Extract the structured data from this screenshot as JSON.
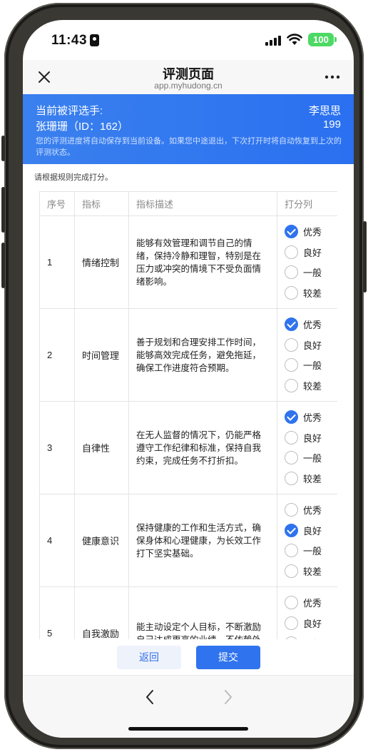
{
  "status": {
    "time": "11:43",
    "battery": "100"
  },
  "nav": {
    "title": "评测页面",
    "url": "app.myhudong.cn"
  },
  "header": {
    "candidate_label": "当前被评选手:",
    "candidate_name": "张珊珊（ID：162）",
    "assessor": "李思思",
    "score": "199",
    "note": "您的评测进度将自动保存到当前设备。如果您中途退出，下次打开时将自动恢复到上次的评测状态。"
  },
  "rule_note": "请根据规则完成打分。",
  "table": {
    "headers": [
      "序号",
      "指标",
      "指标描述",
      "打分列"
    ],
    "options": [
      "优秀",
      "良好",
      "一般",
      "较差"
    ],
    "rows": [
      {
        "index": "1",
        "indicator": "情绪控制",
        "description": "能够有效管理和调节自己的情绪，保持冷静和理智，特别是在压力或冲突的情境下不受负面情绪影响。",
        "selected": "优秀"
      },
      {
        "index": "2",
        "indicator": "时间管理",
        "description": "善于规划和合理安排工作时间，能够高效完成任务，避免拖延，确保工作进度符合预期。",
        "selected": "优秀"
      },
      {
        "index": "3",
        "indicator": "自律性",
        "description": "在无人监督的情况下，仍能严格遵守工作纪律和标准，保持自我约束，完成任务不打折扣。",
        "selected": "优秀"
      },
      {
        "index": "4",
        "indicator": "健康意识",
        "description": "保持健康的工作和生活方式，确保身体和心理健康，为长效工作打下坚实基础。",
        "selected": "良好"
      },
      {
        "index": "5",
        "indicator": "自我激励",
        "description": "能主动设定个人目标，不断激励自己达成更高的业绩，不依赖外",
        "selected": ""
      }
    ]
  },
  "footer": {
    "back_label": "返回",
    "submit_label": "提交"
  },
  "colors": {
    "accent": "#2f73ee",
    "battery": "#4cd964"
  }
}
